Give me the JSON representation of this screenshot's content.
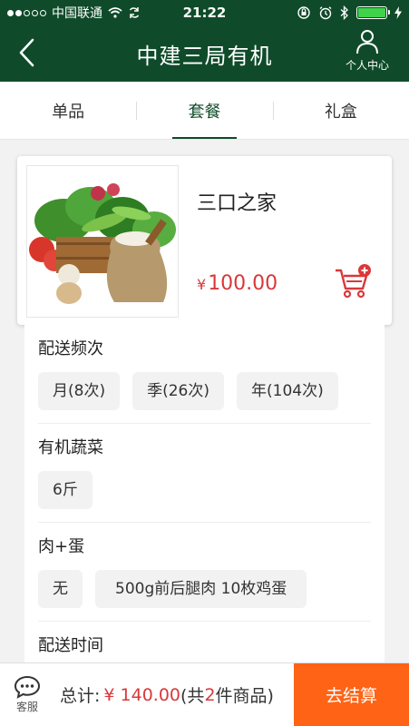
{
  "status_bar": {
    "carrier": "中国联通",
    "time": "21:22"
  },
  "header": {
    "title": "中建三局有机",
    "profile_label": "个人中心"
  },
  "tabs": [
    {
      "label": "单品",
      "active": false
    },
    {
      "label": "套餐",
      "active": true
    },
    {
      "label": "礼盒",
      "active": false
    }
  ],
  "product": {
    "name": "三口之家",
    "currency": "¥",
    "price": "100.00"
  },
  "options": {
    "frequency": {
      "title": "配送频次",
      "chips": [
        "月(8次)",
        "季(26次)",
        "年(104次)"
      ]
    },
    "vegetables": {
      "title": "有机蔬菜",
      "chips": [
        "6斤"
      ]
    },
    "meat_egg": {
      "title": "肉+蛋",
      "chips": [
        "无",
        "500g前后腿肉 10枚鸡蛋"
      ]
    },
    "delivery_time": {
      "title": "配送时间"
    }
  },
  "bottom_bar": {
    "service_label": "客服",
    "total_prefix": "总计:",
    "total_amount": "¥ 140.00",
    "count_prefix": " (共",
    "count": "2",
    "count_suffix": "件商品)",
    "checkout_label": "去结算"
  },
  "colors": {
    "brand_green": "#0f4b2a",
    "price_red": "#d9383a",
    "checkout_orange": "#ff6316"
  }
}
